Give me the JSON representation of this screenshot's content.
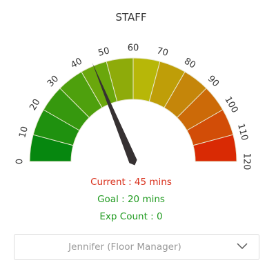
{
  "chart_data": {
    "type": "gauge",
    "title": "STAFF",
    "min": 0,
    "max": 120,
    "value": 45,
    "ticks": [
      "0",
      "10",
      "20",
      "30",
      "40",
      "50",
      "60",
      "70",
      "80",
      "90",
      "100",
      "110",
      "120"
    ],
    "band_colors": [
      "#06870f",
      "#1f910f",
      "#36980e",
      "#4ea00d",
      "#6aa70c",
      "#8eab0a",
      "#b7b708",
      "#bf9e08",
      "#c5860a",
      "#cc6a08",
      "#d24d07",
      "#d92a04"
    ],
    "needle_color": "#363132"
  },
  "stats": {
    "current": "Current : 45 mins",
    "goal": "Goal : 20 mins",
    "exp_count": "Exp Count : 0"
  },
  "selector": {
    "value": "Jennifer (Floor Manager)"
  }
}
